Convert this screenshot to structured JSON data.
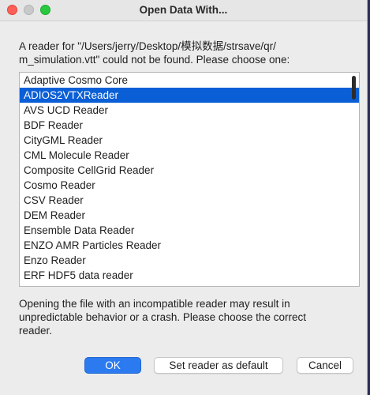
{
  "window": {
    "title": "Open Data With..."
  },
  "message": {
    "line1": "A reader for \"/Users/jerry/Desktop/模拟数据/strsave/qr/",
    "line2": "m_simulation.vtt\" could not be found. Please choose one:"
  },
  "readers": [
    {
      "label": "Adaptive Cosmo Core",
      "selected": false
    },
    {
      "label": "ADIOS2VTXReader",
      "selected": true
    },
    {
      "label": "AVS UCD Reader",
      "selected": false
    },
    {
      "label": "BDF Reader",
      "selected": false
    },
    {
      "label": "CityGML Reader",
      "selected": false
    },
    {
      "label": "CML Molecule Reader",
      "selected": false
    },
    {
      "label": "Composite CellGrid Reader",
      "selected": false
    },
    {
      "label": "Cosmo Reader",
      "selected": false
    },
    {
      "label": "CSV Reader",
      "selected": false
    },
    {
      "label": "DEM Reader",
      "selected": false
    },
    {
      "label": "Ensemble Data Reader",
      "selected": false
    },
    {
      "label": "ENZO AMR Particles Reader",
      "selected": false
    },
    {
      "label": "Enzo Reader",
      "selected": false
    },
    {
      "label": "ERF HDF5 data reader",
      "selected": false
    }
  ],
  "warning": {
    "line1": "Opening the file with an incompatible reader may result in",
    "line2": "unpredictable behavior or a crash.  Please choose the correct",
    "line3": "reader."
  },
  "buttons": {
    "ok": "OK",
    "set_default": "Set reader as default",
    "cancel": "Cancel"
  },
  "colors": {
    "selection": "#0a5fd6",
    "default_button": "#2b7af0",
    "close_light": "#ff5f57",
    "zoom_light": "#28c840"
  }
}
